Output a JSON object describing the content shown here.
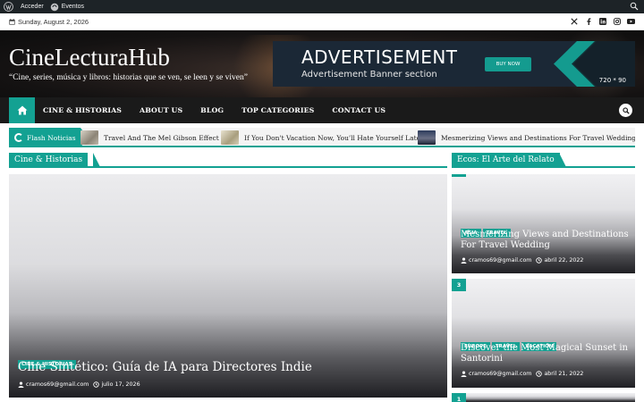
{
  "adminbar": {
    "login_label": "Acceder",
    "events_label": "Eventos"
  },
  "topbar": {
    "date": "Sunday, August 2, 2026",
    "social_icons": [
      "x-icon",
      "facebook-icon",
      "linkedin-icon",
      "instagram-icon",
      "youtube-icon"
    ]
  },
  "header": {
    "site_title": "CineLecturaHub",
    "tagline": "“Cine, series, música y libros: historias que se ven, se leen y se viven”",
    "ad": {
      "title": "ADVERTISEMENT",
      "subtitle": "Advertisement Banner section",
      "button": "BUY NOW",
      "size": "720 * 90"
    }
  },
  "nav": {
    "items": [
      "CINE & HISTORIAS",
      "ABOUT US",
      "BLOG",
      "TOP CATEGORIES",
      "CONTACT US"
    ]
  },
  "flash": {
    "label": "Flash Noticias",
    "items": [
      "Travel And The Mel Gibson Effect",
      "If You Don't Vacation Now, You'll Hate Yourself Later",
      "Mesmerizing Views and Destinations For Travel Wedding"
    ]
  },
  "main": {
    "section_title": "Cine & Historias",
    "feature": {
      "category": "CINE & HISTORIAS",
      "title": "Cine Sintético: Guía de IA para Directores Indie",
      "author": "cramos69@gmail.com",
      "date": "julio 17, 2026"
    }
  },
  "sidebar": {
    "section_title": "Ecos: El Arte del Relato",
    "cards": [
      {
        "number": "",
        "categories": [
          "ASIA",
          "TRAVEL"
        ],
        "title": "Mesmerizing Views and Destinations For Travel Wedding",
        "author": "cramos69@gmail.com",
        "date": "abril 22, 2022"
      },
      {
        "number": "3",
        "categories": [
          "EUROPE",
          "TRAVEL",
          "VACATION"
        ],
        "title": "Discover the Most Magical Sunset in Santorini",
        "author": "cramos69@gmail.com",
        "date": "abril 21, 2022"
      },
      {
        "number": "1"
      }
    ]
  },
  "colors": {
    "accent": "#13a192",
    "nav_bg": "#1a1a1a",
    "adminbar_bg": "#1d2327"
  }
}
